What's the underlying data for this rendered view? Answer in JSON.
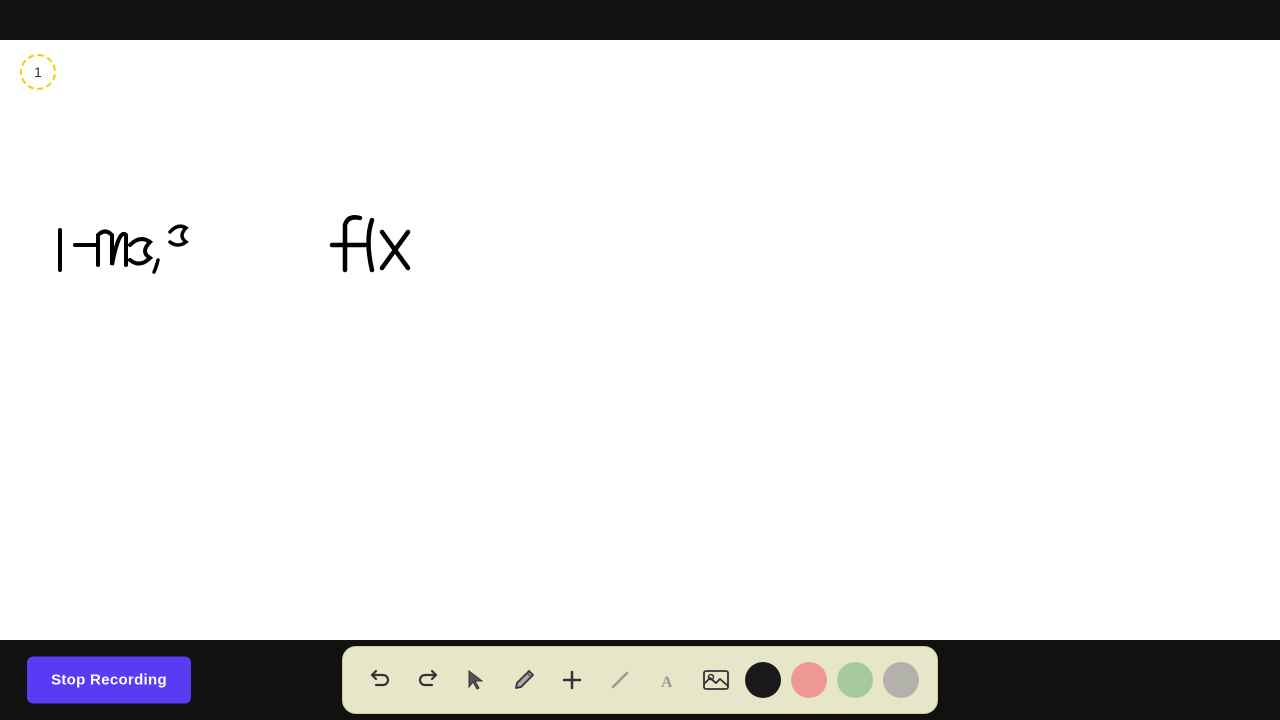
{
  "topBar": {
    "height": 40
  },
  "canvas": {
    "pageNumber": "1",
    "writingLeft": "-1m3, ³",
    "writingRight": "f(x"
  },
  "toolbar": {
    "undo_label": "↩",
    "redo_label": "↪",
    "select_label": "▲",
    "pen_label": "✏",
    "add_label": "+",
    "eraser_label": "/",
    "text_label": "A",
    "image_label": "🖼",
    "colors": [
      "#1a1a1a",
      "#f08080",
      "#90c090",
      "#a0a0a0"
    ]
  },
  "stopRecording": {
    "label": "Stop Recording",
    "bg": "#5b3af5"
  }
}
